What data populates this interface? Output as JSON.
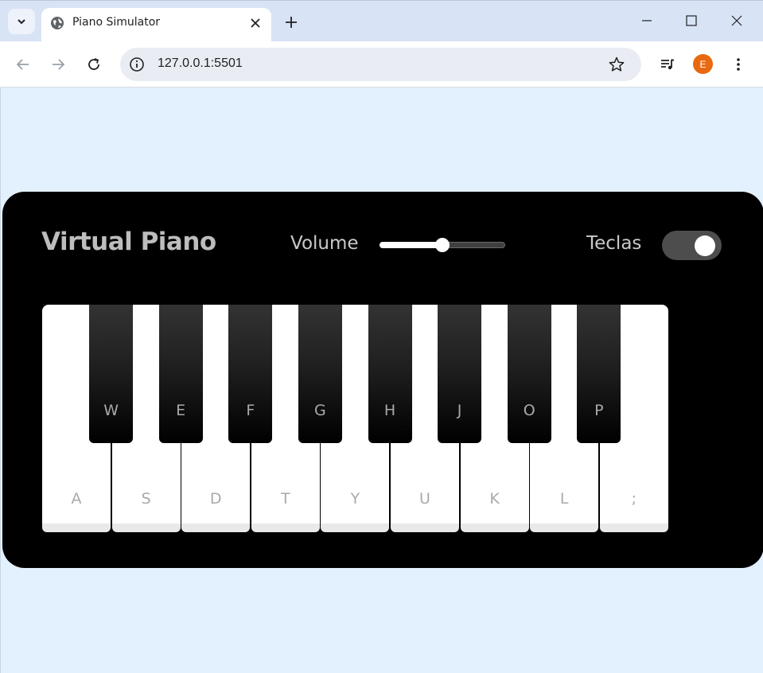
{
  "browser": {
    "tab_title": "Piano Simulator",
    "url": "127.0.0.1:5501",
    "profile_initial": "E",
    "icons": {
      "tab_search": "chevron-down-icon",
      "favicon": "globe-icon",
      "tab_close": "close-icon",
      "new_tab": "plus-icon",
      "minimize": "minimize-icon",
      "maximize": "maximize-icon",
      "window_close": "close-icon",
      "back": "arrow-left-icon",
      "forward": "arrow-right-icon",
      "reload": "reload-icon",
      "site_info": "info-icon",
      "bookmark": "star-icon",
      "media": "media-controls-icon",
      "menu": "kebab-menu-icon"
    },
    "colors": {
      "profile": "#e8690f",
      "tabbar": "#d8e3f6"
    }
  },
  "piano": {
    "title": "Virtual Piano",
    "volume_label": "Volume",
    "volume_value": 0.5,
    "keys_toggle_label": "Teclas",
    "keys_toggle_on": true,
    "white_keys": [
      "A",
      "S",
      "D",
      "T",
      "Y",
      "U",
      "K",
      "L",
      ";"
    ],
    "black_keys": [
      "W",
      "E",
      "F",
      "G",
      "H",
      "J",
      "O",
      "P"
    ],
    "colors": {
      "background": "#e3f0fd",
      "panel": "#000000",
      "key_label": "#a9a9a9"
    }
  }
}
